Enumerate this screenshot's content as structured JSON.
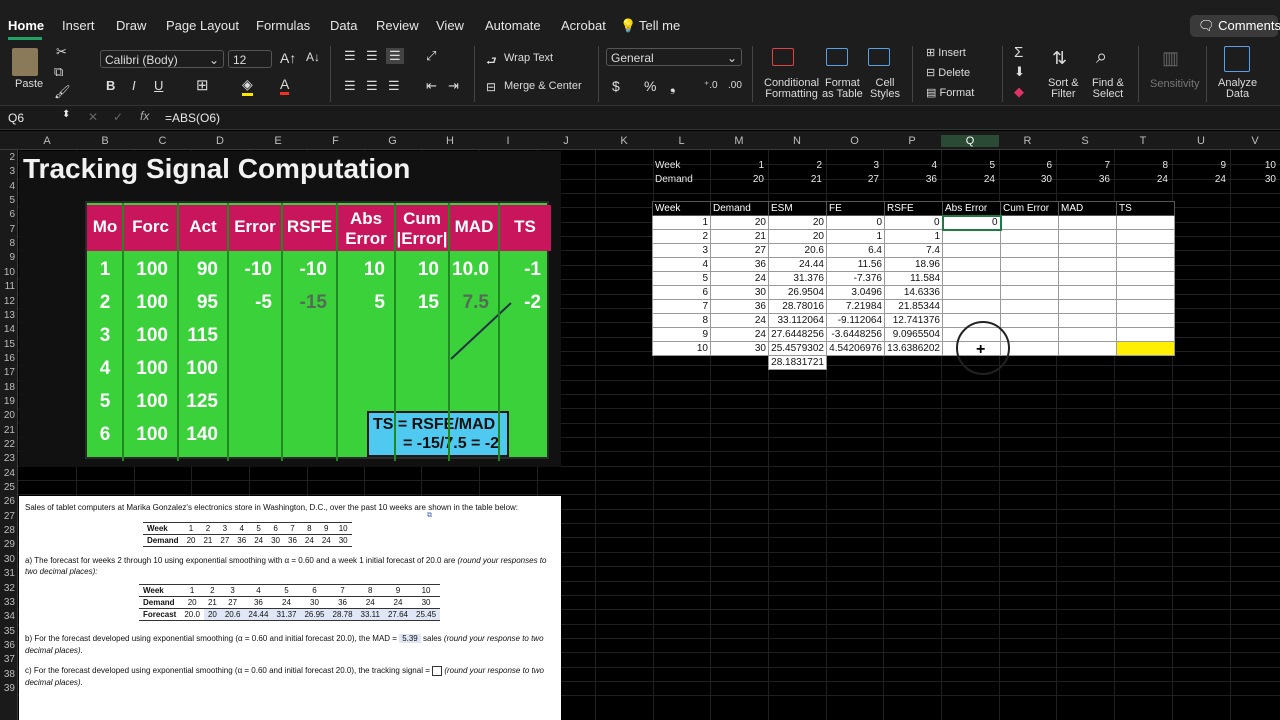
{
  "menu": {
    "tabs": [
      "Home",
      "Insert",
      "Draw",
      "Page Layout",
      "Formulas",
      "Data",
      "Review",
      "View",
      "Automate",
      "Acrobat"
    ],
    "tell_me": "Tell me",
    "comments": "Comments"
  },
  "ribbon": {
    "paste": "Paste",
    "font_name": "Calibri (Body)",
    "font_size": "12",
    "bold": "B",
    "italic": "I",
    "underline": "U",
    "wrap_text": "Wrap Text",
    "merge_center": "Merge & Center",
    "number_format": "General",
    "currency": "$",
    "percent": "%",
    "comma": "❟",
    "conditional": [
      "Conditional",
      "Formatting"
    ],
    "format_table": [
      "Format",
      "as Table"
    ],
    "cell_styles": [
      "Cell",
      "Styles"
    ],
    "insert": "Insert",
    "delete": "Delete",
    "format": "Format",
    "sort_filter": [
      "Sort &",
      "Filter"
    ],
    "find_select": [
      "Find &",
      "Select"
    ],
    "sensitivity": "Sensitivity",
    "analyze": [
      "Analyze",
      "Data"
    ]
  },
  "formula_bar": {
    "name_box": "Q6",
    "fx": "fx",
    "formula": "=ABS(O6)"
  },
  "columns": [
    "A",
    "B",
    "C",
    "D",
    "E",
    "F",
    "G",
    "H",
    "I",
    "J",
    "K",
    "L",
    "M",
    "N",
    "O",
    "P",
    "Q",
    "R",
    "S",
    "T",
    "U",
    "V"
  ],
  "rows": [
    "2",
    "3",
    "4",
    "5",
    "6",
    "7",
    "8",
    "9",
    "10",
    "11",
    "12",
    "13",
    "14",
    "15",
    "16",
    "17",
    "18",
    "19",
    "20",
    "21",
    "22",
    "23",
    "24",
    "25",
    "26",
    "27",
    "28",
    "29",
    "30",
    "31",
    "32",
    "33",
    "34",
    "35",
    "36",
    "37",
    "38",
    "39"
  ],
  "slide": {
    "title": "Tracking Signal Computation",
    "headers": [
      [
        "Mo"
      ],
      [
        "Forc"
      ],
      [
        "Act"
      ],
      [
        "Error"
      ],
      [
        "RSFE"
      ],
      [
        "Abs",
        "Error"
      ],
      [
        "Cum",
        "|Error|"
      ],
      [
        "MAD"
      ],
      [
        "TS"
      ]
    ],
    "rows": [
      [
        "1",
        "100",
        "90",
        "-10",
        "-10",
        "10",
        "10",
        "10.0",
        "-1"
      ],
      [
        "2",
        "100",
        "95",
        "-5",
        "-15",
        "5",
        "15",
        "7.5",
        "-2"
      ],
      [
        "3",
        "100",
        "115",
        "",
        "",
        "",
        "",
        "",
        ""
      ],
      [
        "4",
        "100",
        "100",
        "",
        "",
        "",
        "",
        "",
        ""
      ],
      [
        "5",
        "100",
        "125",
        "",
        "",
        "",
        "",
        "",
        ""
      ],
      [
        "6",
        "100",
        "140",
        "",
        "",
        "",
        "",
        "",
        ""
      ]
    ],
    "callout": [
      "TS = RSFE/MAD",
      "= -15/7.5 = -2"
    ]
  },
  "problem": {
    "intro": "Sales of tablet computers at Marika Gonzalez's electronics store in Washington, D.C., over the past 10 weeks are shown in the table below:",
    "table1": {
      "week_label": "Week",
      "demand_label": "Demand",
      "weeks": [
        "1",
        "2",
        "3",
        "4",
        "5",
        "6",
        "7",
        "8",
        "9",
        "10"
      ],
      "demand": [
        "20",
        "21",
        "27",
        "36",
        "24",
        "30",
        "36",
        "24",
        "24",
        "30"
      ]
    },
    "q_a": "a) The forecast for weeks 2 through 10 using exponential smoothing with α = 0.60 and a week 1 initial forecast of 20.0 are",
    "q_a_italic": "(round your responses to",
    "q_a2": "two decimal places):",
    "table2": {
      "week_label": "Week",
      "demand_label": "Demand",
      "forecast_label": "Forecast",
      "weeks": [
        "1",
        "2",
        "3",
        "4",
        "5",
        "6",
        "7",
        "8",
        "9",
        "10"
      ],
      "demand": [
        "20",
        "21",
        "27",
        "36",
        "24",
        "30",
        "36",
        "24",
        "24",
        "30"
      ],
      "forecast": [
        "20.0",
        "20",
        "20.6",
        "24.44",
        "31.37",
        "26.95",
        "28.78",
        "33.11",
        "27.64",
        "25.45"
      ]
    },
    "q_b": "b) For the forecast developed using exponential smoothing (α = 0.60 and initial forecast 20.0), the MAD =",
    "q_b_value": "5.39",
    "q_b_unit": "sales",
    "q_b_italic": "(round your response to two",
    "q_b2": "decimal places).",
    "q_c": "c) For the forecast developed using exponential smoothing (α = 0.60 and initial forecast 20.0), the tracking signal =",
    "q_c_italic": "(round your response to two",
    "q_c2": "decimal places)."
  },
  "sheet": {
    "week_label": "Week",
    "demand_label": "Demand",
    "weeks": [
      "1",
      "2",
      "3",
      "4",
      "5",
      "6",
      "7",
      "8",
      "9",
      "10"
    ],
    "demand": [
      "20",
      "21",
      "27",
      "36",
      "24",
      "30",
      "36",
      "24",
      "24",
      "30"
    ],
    "headers": [
      "Week",
      "Demand",
      "ESM",
      "FE",
      "RSFE",
      "Abs Error",
      "Cum Error",
      "MAD",
      "TS"
    ],
    "rows": [
      [
        "1",
        "20",
        "20",
        "0",
        "0",
        "0",
        "",
        "",
        ""
      ],
      [
        "2",
        "21",
        "20",
        "1",
        "1",
        "",
        "",
        "",
        ""
      ],
      [
        "3",
        "27",
        "20.6",
        "6.4",
        "7.4",
        "",
        "",
        "",
        ""
      ],
      [
        "4",
        "36",
        "24.44",
        "11.56",
        "18.96",
        "",
        "",
        "",
        ""
      ],
      [
        "5",
        "24",
        "31.376",
        "-7.376",
        "11.584",
        "",
        "",
        "",
        ""
      ],
      [
        "6",
        "30",
        "26.9504",
        "3.0496",
        "14.6336",
        "",
        "",
        "",
        ""
      ],
      [
        "7",
        "36",
        "28.78016",
        "7.21984",
        "21.85344",
        "",
        "",
        "",
        ""
      ],
      [
        "8",
        "24",
        "33.112064",
        "-9.112064",
        "12.741376",
        "",
        "",
        "",
        ""
      ],
      [
        "9",
        "24",
        "27.6448256",
        "-3.6448256",
        "9.0965504",
        "",
        "",
        "",
        ""
      ],
      [
        "10",
        "30",
        "25.4579302",
        "4.54206976",
        "13.6386202",
        "",
        "",
        "",
        ""
      ]
    ],
    "extra_esm": "28.1831721"
  },
  "colors": {
    "accent_green": "#21a366",
    "slide_green": "#3ad13a",
    "slide_header": "#c8155c",
    "callout": "#4fc9ef",
    "highlight": "#ffef00"
  }
}
